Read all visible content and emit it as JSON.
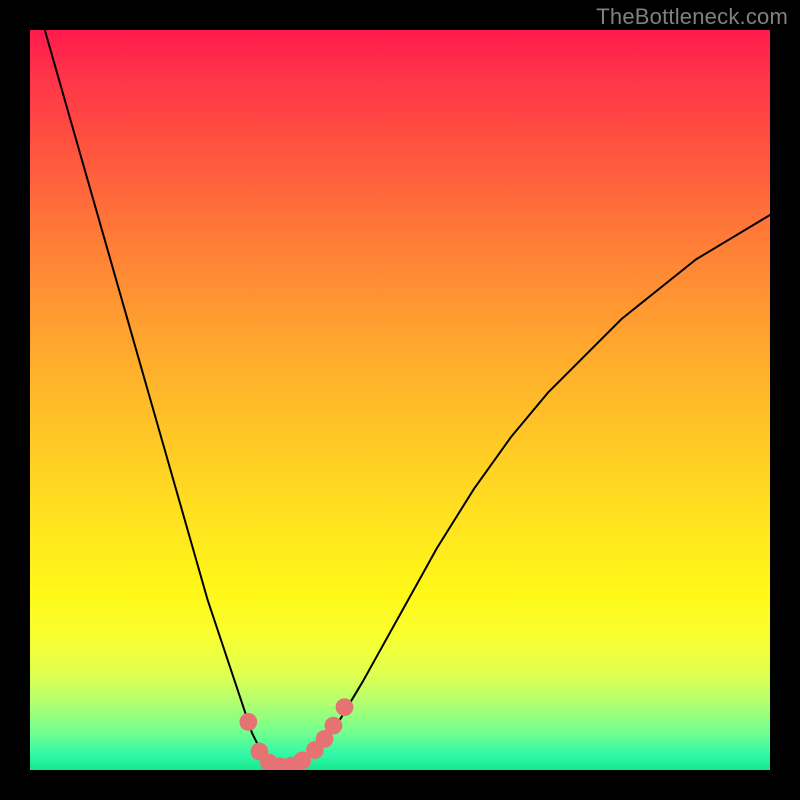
{
  "watermark": "TheBottleneck.com",
  "colors": {
    "background_frame": "#000000",
    "curve": "#000000",
    "marker_fill": "#e57373",
    "gradient_top": "#ff1a4d",
    "gradient_bottom": "#17e88d",
    "watermark": "#808080"
  },
  "chart_data": {
    "type": "line",
    "title": "",
    "xlabel": "",
    "ylabel": "",
    "x_range": [
      0,
      100
    ],
    "y_range": [
      0,
      100
    ],
    "series": [
      {
        "name": "bottleneck-curve",
        "x": [
          0,
          2,
          4,
          6,
          8,
          10,
          12,
          14,
          16,
          18,
          20,
          22,
          24,
          26,
          28,
          30,
          31,
          32,
          33,
          34,
          35,
          36,
          38,
          40,
          42,
          45,
          50,
          55,
          60,
          65,
          70,
          75,
          80,
          85,
          90,
          95,
          100
        ],
        "y": [
          107,
          100,
          93,
          86,
          79,
          72,
          65,
          58,
          51,
          44,
          37,
          30,
          23,
          17,
          11,
          5,
          3,
          1.5,
          0.8,
          0.5,
          0.5,
          0.9,
          2,
          4,
          7,
          12,
          21,
          30,
          38,
          45,
          51,
          56,
          61,
          65,
          69,
          72,
          75
        ]
      }
    ],
    "markers": [
      {
        "x": 29.5,
        "y": 6.5
      },
      {
        "x": 31.0,
        "y": 2.5
      },
      {
        "x": 32.3,
        "y": 1.0
      },
      {
        "x": 33.8,
        "y": 0.5
      },
      {
        "x": 35.3,
        "y": 0.6
      },
      {
        "x": 36.8,
        "y": 1.3
      },
      {
        "x": 38.5,
        "y": 2.7
      },
      {
        "x": 39.8,
        "y": 4.2
      },
      {
        "x": 41.0,
        "y": 6.0
      },
      {
        "x": 42.5,
        "y": 8.5
      }
    ],
    "marker_radius": 1.2,
    "notes": "V-shaped bottleneck curve over a vertical red→green gradient. Curve minimum (bottleneck-free point) near x≈34. No visible axes, ticks, or legend."
  }
}
